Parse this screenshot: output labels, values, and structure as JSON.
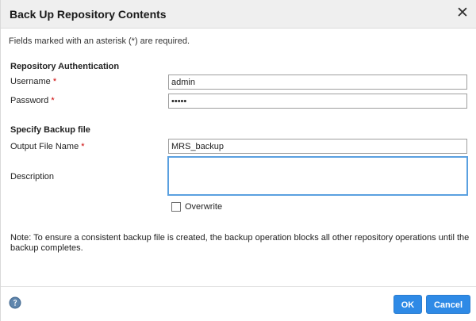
{
  "dialog": {
    "title": "Back Up Repository Contents",
    "close_icon": "close-icon",
    "required_note": "Fields marked with an asterisk (*) are required."
  },
  "authentication": {
    "section_title": "Repository Authentication",
    "username_label": "Username",
    "username_value": "admin",
    "password_label": "Password",
    "password_value": "•••••",
    "required_marker": "*"
  },
  "backup": {
    "section_title": "Specify Backup file",
    "output_label": "Output File Name",
    "output_value": "MRS_backup",
    "description_label": "Description",
    "description_value": "",
    "overwrite_label": "Overwrite",
    "overwrite_checked": false
  },
  "note": "Note: To ensure a consistent backup file is created, the backup operation blocks all other repository operations until the backup completes.",
  "footer": {
    "help_icon": "help-icon",
    "ok_label": "OK",
    "cancel_label": "Cancel"
  },
  "colors": {
    "accent": "#2e8ae6",
    "required": "#cc0000",
    "focus_border": "#5aa0e0",
    "titlebar": "#efefef"
  }
}
